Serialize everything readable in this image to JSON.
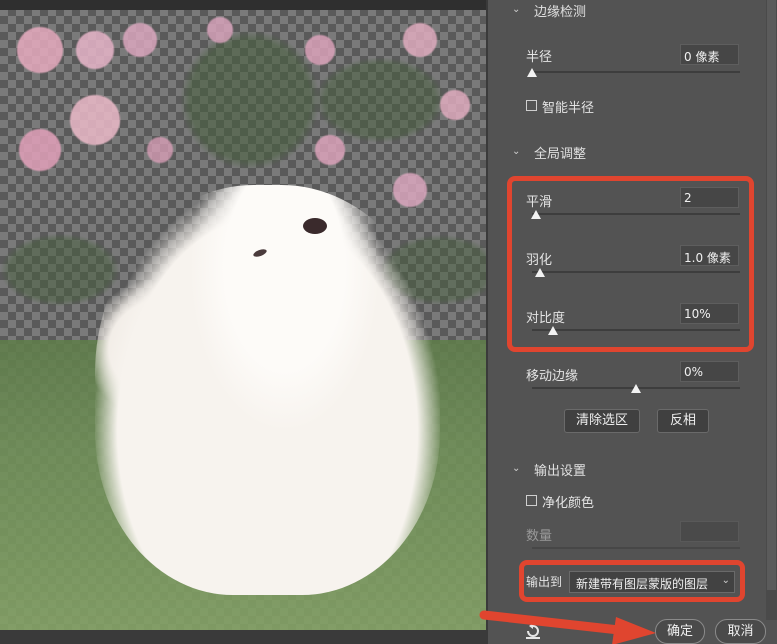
{
  "edge_detection": {
    "title": "边缘检测",
    "radius_label": "半径",
    "radius_value": "0 像素",
    "radius_level": 0,
    "smart_radius_label": "智能半径",
    "smart_radius_checked": false
  },
  "global_refinements": {
    "title": "全局调整",
    "smooth_label": "平滑",
    "smooth_value": "2",
    "smooth_level": 0.02,
    "feather_label": "羽化",
    "feather_value": "1.0 像素",
    "feather_level": 0.04,
    "contrast_label": "对比度",
    "contrast_value": "10%",
    "contrast_level": 0.1,
    "shift_edge_label": "移动边缘",
    "shift_edge_value": "0%",
    "shift_edge_level": 0.5,
    "clear_selection_label": "清除选区",
    "invert_label": "反相"
  },
  "output_settings": {
    "title": "输出设置",
    "decontaminate_label": "净化颜色",
    "decontaminate_checked": false,
    "amount_label": "数量",
    "amount_value": "",
    "output_to_label": "输出到",
    "output_to_value": "新建带有图层蒙版的图层"
  },
  "footer": {
    "ok_label": "确定",
    "cancel_label": "取消"
  },
  "colors": {
    "highlight": "#e0452f",
    "panel_bg": "#535353"
  },
  "icons": {
    "chevron": "chevron-down-icon",
    "reset": "reset-icon",
    "select_caret": "chevron-down-icon"
  }
}
